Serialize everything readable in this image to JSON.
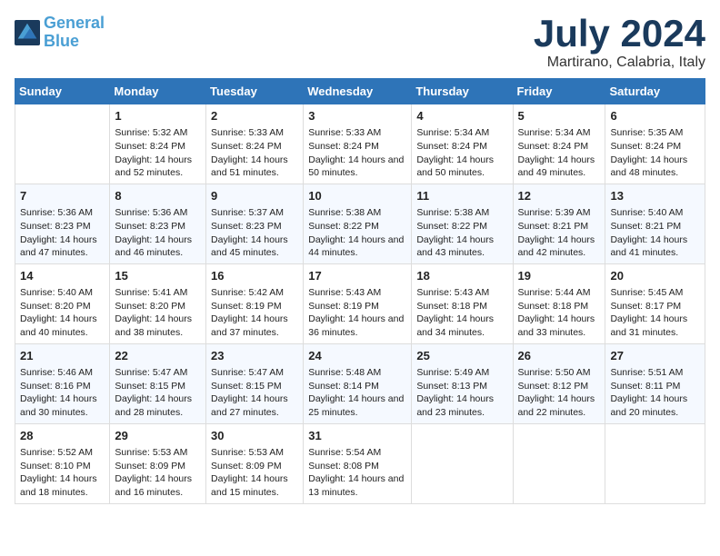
{
  "header": {
    "logo_line1": "General",
    "logo_line2": "Blue",
    "month": "July 2024",
    "location": "Martirano, Calabria, Italy"
  },
  "weekdays": [
    "Sunday",
    "Monday",
    "Tuesday",
    "Wednesday",
    "Thursday",
    "Friday",
    "Saturday"
  ],
  "weeks": [
    [
      {
        "day": "",
        "sunrise": "",
        "sunset": "",
        "daylight": ""
      },
      {
        "day": "1",
        "sunrise": "Sunrise: 5:32 AM",
        "sunset": "Sunset: 8:24 PM",
        "daylight": "Daylight: 14 hours and 52 minutes."
      },
      {
        "day": "2",
        "sunrise": "Sunrise: 5:33 AM",
        "sunset": "Sunset: 8:24 PM",
        "daylight": "Daylight: 14 hours and 51 minutes."
      },
      {
        "day": "3",
        "sunrise": "Sunrise: 5:33 AM",
        "sunset": "Sunset: 8:24 PM",
        "daylight": "Daylight: 14 hours and 50 minutes."
      },
      {
        "day": "4",
        "sunrise": "Sunrise: 5:34 AM",
        "sunset": "Sunset: 8:24 PM",
        "daylight": "Daylight: 14 hours and 50 minutes."
      },
      {
        "day": "5",
        "sunrise": "Sunrise: 5:34 AM",
        "sunset": "Sunset: 8:24 PM",
        "daylight": "Daylight: 14 hours and 49 minutes."
      },
      {
        "day": "6",
        "sunrise": "Sunrise: 5:35 AM",
        "sunset": "Sunset: 8:24 PM",
        "daylight": "Daylight: 14 hours and 48 minutes."
      }
    ],
    [
      {
        "day": "7",
        "sunrise": "Sunrise: 5:36 AM",
        "sunset": "Sunset: 8:23 PM",
        "daylight": "Daylight: 14 hours and 47 minutes."
      },
      {
        "day": "8",
        "sunrise": "Sunrise: 5:36 AM",
        "sunset": "Sunset: 8:23 PM",
        "daylight": "Daylight: 14 hours and 46 minutes."
      },
      {
        "day": "9",
        "sunrise": "Sunrise: 5:37 AM",
        "sunset": "Sunset: 8:23 PM",
        "daylight": "Daylight: 14 hours and 45 minutes."
      },
      {
        "day": "10",
        "sunrise": "Sunrise: 5:38 AM",
        "sunset": "Sunset: 8:22 PM",
        "daylight": "Daylight: 14 hours and 44 minutes."
      },
      {
        "day": "11",
        "sunrise": "Sunrise: 5:38 AM",
        "sunset": "Sunset: 8:22 PM",
        "daylight": "Daylight: 14 hours and 43 minutes."
      },
      {
        "day": "12",
        "sunrise": "Sunrise: 5:39 AM",
        "sunset": "Sunset: 8:21 PM",
        "daylight": "Daylight: 14 hours and 42 minutes."
      },
      {
        "day": "13",
        "sunrise": "Sunrise: 5:40 AM",
        "sunset": "Sunset: 8:21 PM",
        "daylight": "Daylight: 14 hours and 41 minutes."
      }
    ],
    [
      {
        "day": "14",
        "sunrise": "Sunrise: 5:40 AM",
        "sunset": "Sunset: 8:20 PM",
        "daylight": "Daylight: 14 hours and 40 minutes."
      },
      {
        "day": "15",
        "sunrise": "Sunrise: 5:41 AM",
        "sunset": "Sunset: 8:20 PM",
        "daylight": "Daylight: 14 hours and 38 minutes."
      },
      {
        "day": "16",
        "sunrise": "Sunrise: 5:42 AM",
        "sunset": "Sunset: 8:19 PM",
        "daylight": "Daylight: 14 hours and 37 minutes."
      },
      {
        "day": "17",
        "sunrise": "Sunrise: 5:43 AM",
        "sunset": "Sunset: 8:19 PM",
        "daylight": "Daylight: 14 hours and 36 minutes."
      },
      {
        "day": "18",
        "sunrise": "Sunrise: 5:43 AM",
        "sunset": "Sunset: 8:18 PM",
        "daylight": "Daylight: 14 hours and 34 minutes."
      },
      {
        "day": "19",
        "sunrise": "Sunrise: 5:44 AM",
        "sunset": "Sunset: 8:18 PM",
        "daylight": "Daylight: 14 hours and 33 minutes."
      },
      {
        "day": "20",
        "sunrise": "Sunrise: 5:45 AM",
        "sunset": "Sunset: 8:17 PM",
        "daylight": "Daylight: 14 hours and 31 minutes."
      }
    ],
    [
      {
        "day": "21",
        "sunrise": "Sunrise: 5:46 AM",
        "sunset": "Sunset: 8:16 PM",
        "daylight": "Daylight: 14 hours and 30 minutes."
      },
      {
        "day": "22",
        "sunrise": "Sunrise: 5:47 AM",
        "sunset": "Sunset: 8:15 PM",
        "daylight": "Daylight: 14 hours and 28 minutes."
      },
      {
        "day": "23",
        "sunrise": "Sunrise: 5:47 AM",
        "sunset": "Sunset: 8:15 PM",
        "daylight": "Daylight: 14 hours and 27 minutes."
      },
      {
        "day": "24",
        "sunrise": "Sunrise: 5:48 AM",
        "sunset": "Sunset: 8:14 PM",
        "daylight": "Daylight: 14 hours and 25 minutes."
      },
      {
        "day": "25",
        "sunrise": "Sunrise: 5:49 AM",
        "sunset": "Sunset: 8:13 PM",
        "daylight": "Daylight: 14 hours and 23 minutes."
      },
      {
        "day": "26",
        "sunrise": "Sunrise: 5:50 AM",
        "sunset": "Sunset: 8:12 PM",
        "daylight": "Daylight: 14 hours and 22 minutes."
      },
      {
        "day": "27",
        "sunrise": "Sunrise: 5:51 AM",
        "sunset": "Sunset: 8:11 PM",
        "daylight": "Daylight: 14 hours and 20 minutes."
      }
    ],
    [
      {
        "day": "28",
        "sunrise": "Sunrise: 5:52 AM",
        "sunset": "Sunset: 8:10 PM",
        "daylight": "Daylight: 14 hours and 18 minutes."
      },
      {
        "day": "29",
        "sunrise": "Sunrise: 5:53 AM",
        "sunset": "Sunset: 8:09 PM",
        "daylight": "Daylight: 14 hours and 16 minutes."
      },
      {
        "day": "30",
        "sunrise": "Sunrise: 5:53 AM",
        "sunset": "Sunset: 8:09 PM",
        "daylight": "Daylight: 14 hours and 15 minutes."
      },
      {
        "day": "31",
        "sunrise": "Sunrise: 5:54 AM",
        "sunset": "Sunset: 8:08 PM",
        "daylight": "Daylight: 14 hours and 13 minutes."
      },
      {
        "day": "",
        "sunrise": "",
        "sunset": "",
        "daylight": ""
      },
      {
        "day": "",
        "sunrise": "",
        "sunset": "",
        "daylight": ""
      },
      {
        "day": "",
        "sunrise": "",
        "sunset": "",
        "daylight": ""
      }
    ]
  ]
}
